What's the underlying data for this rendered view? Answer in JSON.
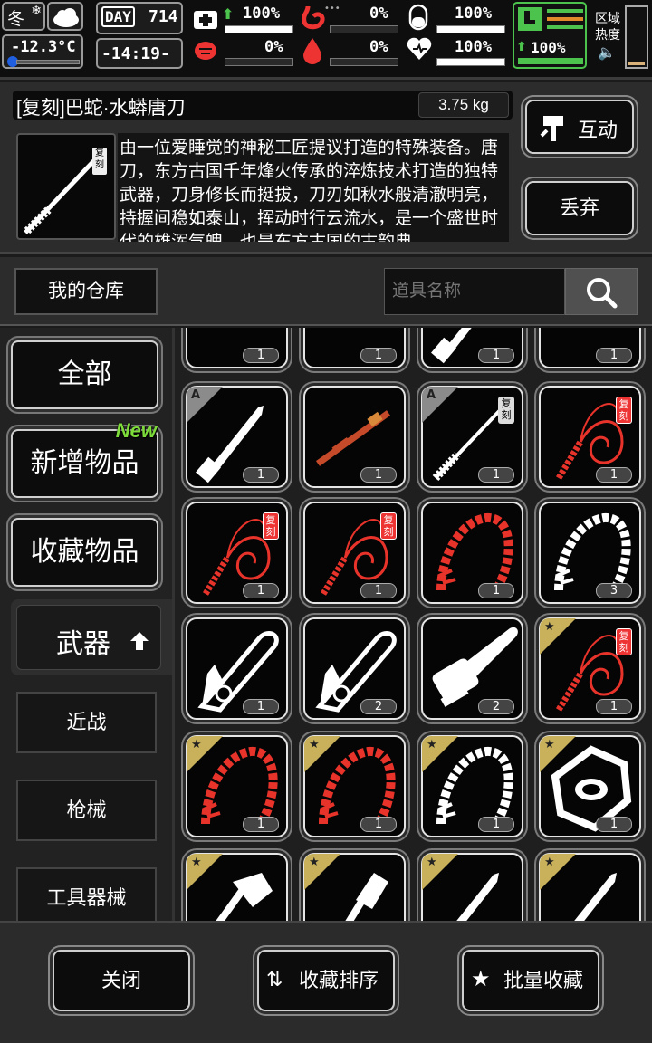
{
  "status": {
    "season": "冬",
    "temperature": "-12.3°C",
    "day_label": "DAY",
    "day_number": "714",
    "time": "-14:19-",
    "health_pct": "100%",
    "stomach_pct": "0%",
    "mind_pct": "100%",
    "energy_pct": "100%",
    "infection_pct": "0%",
    "blood_pct": "0%",
    "heart_pct": "100%",
    "region_heat_label": "区域\n热度",
    "region_heat_l1": "区域",
    "region_heat_l2": "热度",
    "levels": {
      "health": 1.0,
      "stomach": 0.0,
      "mind": 1.0,
      "energy": 1.0,
      "infection": 0.0,
      "blood": 0.0,
      "heart": 1.0
    }
  },
  "detail": {
    "title": "[复刻]巴蛇·水蟒唐刀",
    "weight": "3.75 kg",
    "description": "由一位爱睡觉的神秘工匠提议打造的特殊装备。唐刀，东方古国千年烽火传承的淬炼技术打造的独特武器，刀身修长而挺拔，刀刃如秋水般清澈明亮，持握间稳如泰山，挥动时行云流水，是一个盛世时代的雄浑气魄，也是东方古国的古韵典",
    "fuke_tag": "复刻",
    "interact_label": "互动",
    "discard_label": "丢弃"
  },
  "search": {
    "warehouse_label": "我的仓库",
    "placeholder": "道具名称"
  },
  "categories": {
    "all": "全部",
    "new_items": "新增物品",
    "new_badge": "New",
    "favorites": "收藏物品",
    "weapons": "武器",
    "melee": "近战",
    "firearms": "枪械",
    "tools": "工具器械"
  },
  "grid": {
    "rows": [
      [
        "1",
        "1",
        "1",
        "1"
      ],
      [
        "1",
        "1",
        "1",
        "1"
      ],
      [
        "1",
        "1",
        "1",
        "3"
      ],
      [
        "1",
        "2",
        "2",
        "1"
      ],
      [
        "1",
        "1",
        "1",
        "1"
      ],
      [
        "",
        "",
        "",
        ""
      ]
    ],
    "fuke_tag": "复刻",
    "grade_a": "A"
  },
  "bottom": {
    "close_label": "关闭",
    "sort_label": "收藏排序",
    "batch_label": "批量收藏"
  },
  "colors": {
    "red_item": "#e8332b",
    "gold_corner": "#c9b15b",
    "green_accent": "#4cc34c"
  }
}
